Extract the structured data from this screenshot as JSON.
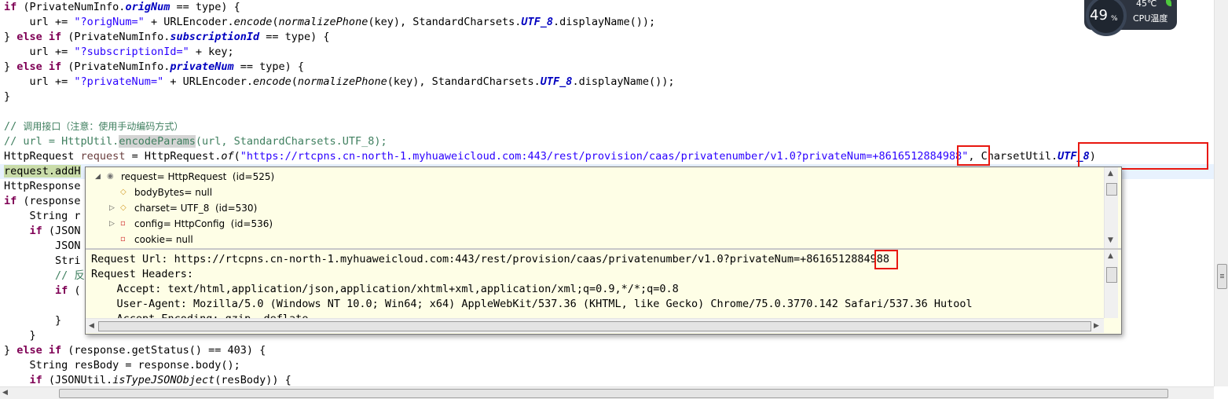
{
  "code": {
    "line1": {
      "a": "if",
      "b": " (PrivateNumInfo.",
      "c": "origNum",
      "d": " == type) {"
    },
    "line2": {
      "a": "    url += ",
      "b": "\"?origNum=\"",
      "c": " + URLEncoder.",
      "d": "encode",
      "e": "(",
      "f": "normalizePhone",
      "g": "(key), StandardCharsets.",
      "h": "UTF_8",
      "i": ".displayName());"
    },
    "line3": {
      "a": "} ",
      "b": "else if",
      "c": " (PrivateNumInfo.",
      "d": "subscriptionId",
      "e": " == type) {"
    },
    "line4": {
      "a": "    url += ",
      "b": "\"?subscriptionId=\"",
      "c": " + key;"
    },
    "line5": {
      "a": "} ",
      "b": "else if",
      "c": " (PrivateNumInfo.",
      "d": "privateNum",
      "e": " == type) {"
    },
    "line6": {
      "a": "    url += ",
      "b": "\"?privateNum=\"",
      "c": " + URLEncoder.",
      "d": "encode",
      "e": "(",
      "f": "normalizePhone",
      "g": "(key), StandardCharsets.",
      "h": "UTF_8",
      "i": ".displayName());"
    },
    "line7": "}",
    "line9": {
      "a": "// ",
      "b": "调用接口（注意：使用手动编码方式）"
    },
    "line10": {
      "a": "// url = HttpUtil.",
      "b": "encodeParams",
      "c": "(url, StandardCharsets.UTF_8);"
    },
    "line11": {
      "a": "HttpRequest ",
      "b": "request",
      "c": " = HttpRequest.",
      "d": "of",
      "e": "(",
      "f": "\"https://rtcpns.cn-north-1.myhuaweicloud.com:443/rest/provision/caas/privatenumber/v1.0?privateNum=+8616512884988\"",
      "g": ", CharsetUtil.",
      "h": "UTF_8",
      "i": ")"
    },
    "line12": {
      "a": "request.addH"
    },
    "line13": "HttpResponse",
    "line14": {
      "a": "if",
      "b": " (response"
    },
    "line15": "    String r",
    "line16": {
      "a": "    if",
      "b": " (JSON"
    },
    "line17": "        JSON",
    "line18": "        Stri",
    "line19": "        // 反",
    "line20": {
      "a": "        if",
      "b": " ("
    },
    "line22": "        }",
    "line23": "    }",
    "line24": {
      "a": "} ",
      "b": "else if",
      "c": " (response.getStatus() == 403) {"
    },
    "line25": "    String resBody = response.body();",
    "line26": {
      "a": "    if",
      "b": " (JSONUtil.",
      "c": "isTypeJSONObject",
      "d": "(resBody)) {"
    }
  },
  "hover": {
    "tree": [
      {
        "label": "request= HttpRequest  (id=525)",
        "icon": "object-icon",
        "expanded": true
      },
      {
        "label": "bodyBytes= null",
        "icon": "field-icon"
      },
      {
        "label": "charset= UTF_8  (id=530)",
        "icon": "field-icon"
      },
      {
        "label": "config= HttpConfig  (id=536)",
        "icon": "private-field-icon"
      },
      {
        "label": "cookie= null",
        "icon": "private-field-icon"
      }
    ],
    "detail": [
      "Request Url: https://rtcpns.cn-north-1.myhuaweicloud.com:443/rest/provision/caas/privatenumber/v1.0?privateNum=+8616512884988",
      "Request Headers:",
      "    Accept: text/html,application/json,application/xhtml+xml,application/xml;q=0.9,*/*;q=0.8",
      "    User-Agent: Mozilla/5.0 (Windows NT 10.0; Win64; x64) AppleWebKit/537.36 (KHTML, like Gecko) Chrome/75.0.3770.142 Safari/537.36 Hutool",
      "    Accept-Encoding: gzip, deflate"
    ]
  },
  "cpu": {
    "percent": "49",
    "percent_sign": "%",
    "temperature": "45℃",
    "label": "CPU温度"
  },
  "colors": {
    "highlight_box": "#e8170f",
    "hover_bg": "#fefee6",
    "keyword": "#7f0055",
    "string": "#2a00ff",
    "comment": "#3f7f5f",
    "field": "#0000c0"
  }
}
